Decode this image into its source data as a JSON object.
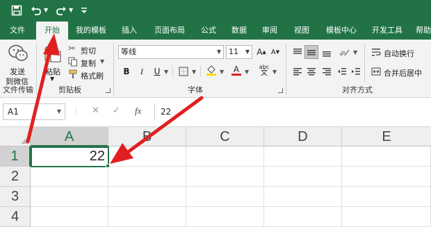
{
  "app": {
    "accent": "#217346",
    "annotation_color": "#e02020"
  },
  "quick_access": {
    "save": "save-icon",
    "undo": "undo-icon",
    "redo": "redo-icon",
    "customize": "customize-icon"
  },
  "tabs": [
    {
      "label": "文件"
    },
    {
      "label": "开始",
      "active": true
    },
    {
      "label": "我的模板"
    },
    {
      "label": "插入"
    },
    {
      "label": "页面布局"
    },
    {
      "label": "公式"
    },
    {
      "label": "数据"
    },
    {
      "label": "审阅"
    },
    {
      "label": "视图"
    },
    {
      "label": "模板中心"
    },
    {
      "label": "开发工具"
    },
    {
      "label": "帮助"
    }
  ],
  "ribbon": {
    "file_transfer": {
      "send_line1": "发送",
      "send_line2": "到微信",
      "group": "文件传输"
    },
    "clipboard": {
      "paste": "粘贴",
      "cut": "剪切",
      "copy": "复制",
      "format_painter": "格式刷",
      "group": "剪贴板"
    },
    "font": {
      "name": "等线",
      "size": "11",
      "bold": "B",
      "italic": "I",
      "underline": "U",
      "group": "字体"
    },
    "alignment": {
      "wrap_text": "自动换行",
      "merge_center": "合并后居中",
      "group": "对齐方式"
    }
  },
  "formula_bar": {
    "name_box": "A1",
    "fx": "fx",
    "value": "22"
  },
  "sheet": {
    "columns": [
      "A",
      "B",
      "C",
      "D",
      "E"
    ],
    "rows": [
      "1",
      "2",
      "3",
      "4"
    ],
    "a1_value": "22"
  }
}
